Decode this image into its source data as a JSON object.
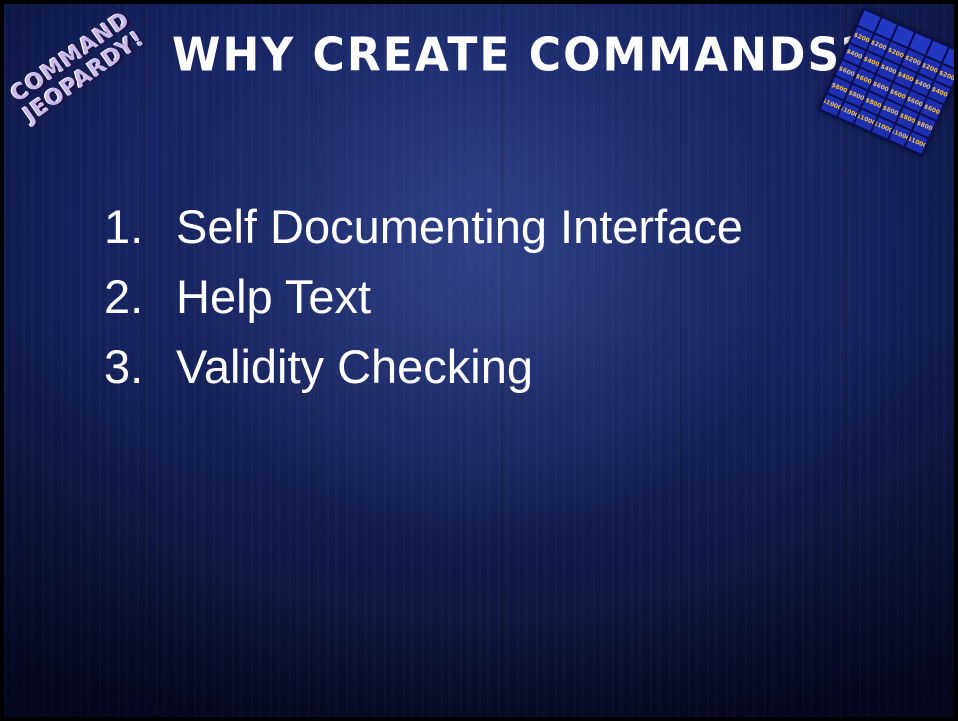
{
  "badge": {
    "line1": "COMMAND",
    "line2": "JEOPARDY!"
  },
  "slide": {
    "title": "WHY CREATE COMMANDS?"
  },
  "board": {
    "cells": [
      "",
      "",
      "",
      "",
      "",
      "",
      "$200",
      "$200",
      "$200",
      "$200",
      "$200",
      "$200",
      "$400",
      "$400",
      "$400",
      "$400",
      "$400",
      "$400",
      "$600",
      "$600",
      "$600",
      "$600",
      "$600",
      "$600",
      "$800",
      "$800",
      "$800",
      "$800",
      "$800",
      "$800",
      "$1000",
      "$1000",
      "$1000",
      "$1000",
      "$1000",
      "$1000"
    ]
  },
  "list": {
    "items": [
      {
        "num": "1.",
        "text": "Self Documenting Interface"
      },
      {
        "num": "2.",
        "text": "Help Text"
      },
      {
        "num": "3.",
        "text": "Validity Checking"
      }
    ]
  }
}
